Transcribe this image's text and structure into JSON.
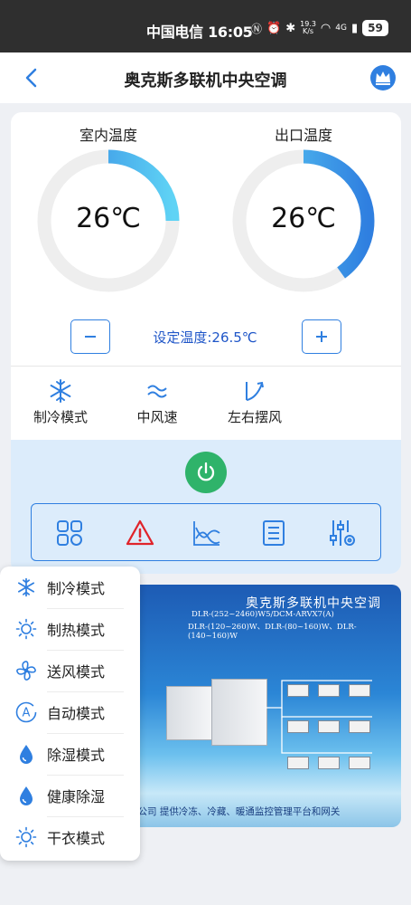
{
  "status_bar": {
    "carrier_time": "中国电信 16:05",
    "net_speed_value": "19.3",
    "net_speed_unit": "K/s",
    "network": "4G",
    "battery": "59"
  },
  "header": {
    "title": "奥克斯多联机中央空调",
    "back_icon": "chevron-left-icon",
    "vip_icon": "crown-icon"
  },
  "gauges": {
    "indoor": {
      "label": "室内温度",
      "value": "26℃",
      "fill_fraction": 0.25
    },
    "outlet": {
      "label": "出口温度",
      "value": "26℃",
      "fill_fraction": 0.4
    }
  },
  "setpoint": {
    "text": "设定温度:26.5℃",
    "minus_icon": "minus-icon",
    "plus_icon": "plus-icon"
  },
  "modes": [
    {
      "label": "制冷模式",
      "icon": "snowflake-icon"
    },
    {
      "label": "中风速",
      "icon": "wind-icon"
    },
    {
      "label": "左右摆风",
      "icon": "swing-icon"
    }
  ],
  "toolbar": {
    "items": [
      "grid-icon",
      "warning-icon",
      "chart-icon",
      "list-icon",
      "settings-sliders-icon"
    ],
    "power_icon": "power-icon"
  },
  "banner": {
    "title": "奥克斯多联机中央空调",
    "model_line1": "DLR-(252~2460)W5/DCM-ARVX7(A)",
    "model_line2": "DLR-(120~260)W、DLR-(80~160)W、DLR-(140~160)W",
    "footer": "限公司    提供冷冻、冷藏、暖通监控管理平台和网关"
  },
  "mode_menu": {
    "items": [
      {
        "label": "制冷模式",
        "icon": "snowflake-icon"
      },
      {
        "label": "制热模式",
        "icon": "sun-icon"
      },
      {
        "label": "送风模式",
        "icon": "fan-icon"
      },
      {
        "label": "自动模式",
        "icon": "auto-icon"
      },
      {
        "label": "除湿模式",
        "icon": "droplet-icon"
      },
      {
        "label": "健康除湿",
        "icon": "droplet-icon"
      },
      {
        "label": "干衣模式",
        "icon": "sun-icon"
      }
    ]
  },
  "colors": {
    "accent": "#2f7fe0",
    "gauge_track": "#eeeeee",
    "power": "#2fb36a",
    "warning": "#e0242b",
    "setpoint_text": "#1f56c8"
  }
}
